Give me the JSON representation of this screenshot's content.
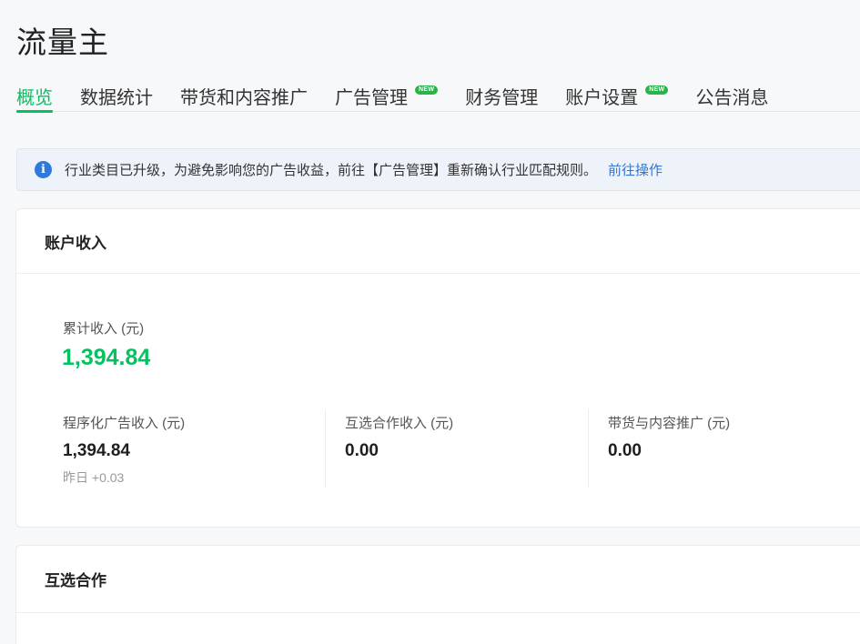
{
  "app_title": "流量主",
  "tabs": [
    {
      "label": "概览",
      "active": true,
      "badge": ""
    },
    {
      "label": "数据统计",
      "active": false,
      "badge": ""
    },
    {
      "label": "带货和内容推广",
      "active": false,
      "badge": ""
    },
    {
      "label": "广告管理",
      "active": false,
      "badge": "NEW"
    },
    {
      "label": "财务管理",
      "active": false,
      "badge": ""
    },
    {
      "label": "账户设置",
      "active": false,
      "badge": "NEW"
    },
    {
      "label": "公告消息",
      "active": false,
      "badge": ""
    }
  ],
  "notice": {
    "icon": "info-icon",
    "text": "行业类目已升级，为避免影响您的广告收益，前往【广告管理】重新确认行业匹配规则。",
    "link": "前往操作"
  },
  "income_card": {
    "title": "账户收入",
    "total_label": "累计收入 (元)",
    "total_value": "1,394.84",
    "metrics": [
      {
        "label": "程序化广告收入 (元)",
        "value": "1,394.84",
        "delta": "昨日 +0.03"
      },
      {
        "label": "互选合作收入 (元)",
        "value": "0.00",
        "delta": ""
      },
      {
        "label": "带货与内容推广 (元)",
        "value": "0.00",
        "delta": ""
      }
    ]
  },
  "coop_card": {
    "title": "互选合作"
  },
  "colors": {
    "accent": "#07c160",
    "link": "#3775c9",
    "badge": "#2ab34a",
    "info_icon": "#2f7ad8"
  }
}
